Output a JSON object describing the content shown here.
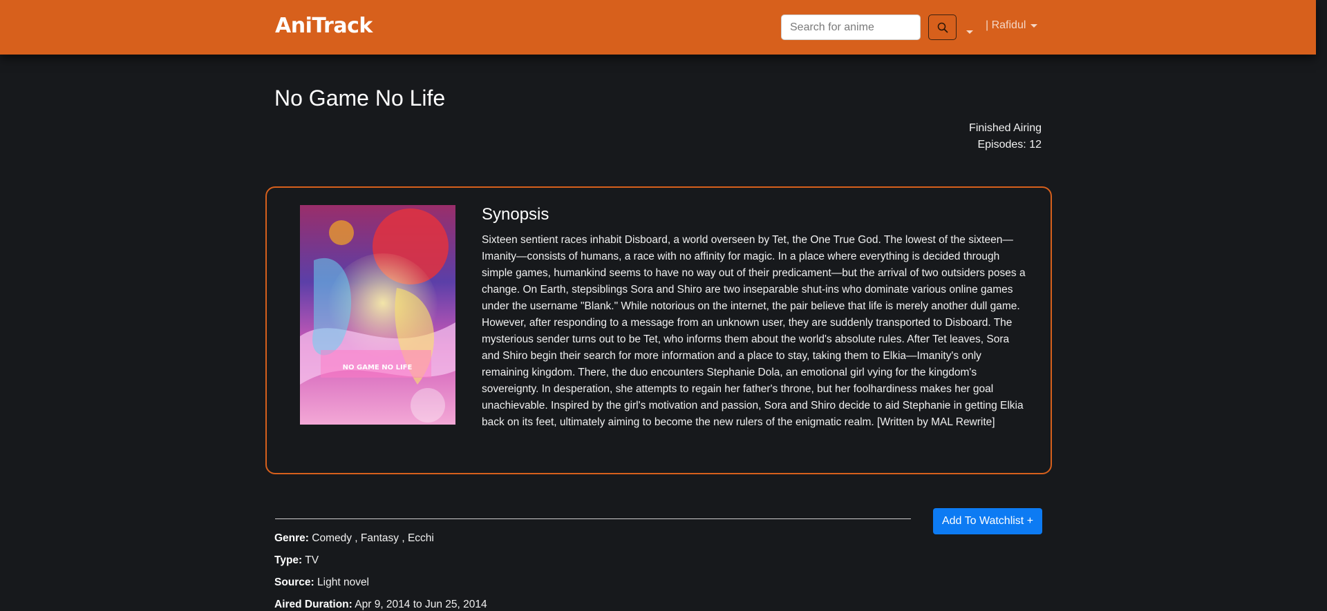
{
  "nav": {
    "brand": "AniTrack",
    "search_placeholder": "Search for anime",
    "search_value": "",
    "user_label": "| Rafidul"
  },
  "anime": {
    "title": "No Game No Life",
    "status": "Finished Airing",
    "episodes": "Episodes: 12",
    "poster_title_text": "NO GAME NO LIFE",
    "synopsis_heading": "Synopsis",
    "synopsis": "Sixteen sentient races inhabit Disboard, a world overseen by Tet, the One True God. The lowest of the sixteen—Imanity—consists of humans, a race with no affinity for magic. In a place where everything is decided through simple games, humankind seems to have no way out of their predicament—but the arrival of two outsiders poses a change. On Earth, stepsiblings Sora and Shiro are two inseparable shut-ins who dominate various online games under the username \"Blank.\" While notorious on the internet, the pair believe that life is merely another dull game. However, after responding to a message from an unknown user, they are suddenly transported to Disboard. The mysterious sender turns out to be Tet, who informs them about the world's absolute rules. After Tet leaves, Sora and Shiro begin their search for more information and a place to stay, taking them to Elkia—Imanity's only remaining kingdom. There, the duo encounters Stephanie Dola, an emotional girl vying for the kingdom's sovereignty. In desperation, she attempts to regain her father's throne, but her foolhardiness makes her goal unachievable. Inspired by the girl's motivation and passion, Sora and Shiro decide to aid Stephanie in getting Elkia back on its feet, ultimately aiming to become the new rulers of the enigmatic realm. [Written by MAL Rewrite]"
  },
  "actions": {
    "add_watchlist": "Add To Watchlist +"
  },
  "details": {
    "genre_label": "Genre:",
    "genre_value": "Comedy , Fantasy , Ecchi",
    "type_label": "Type:",
    "type_value": "TV",
    "source_label": "Source:",
    "source_value": "Light novel",
    "aired_label": "Aired Duration:",
    "aired_value": "Apr 9, 2014 to Jun 25, 2014"
  },
  "colors": {
    "navbar": "#d7601c",
    "background": "#17191c",
    "accent_border": "#d7601c",
    "primary_button": "#0d7bf3"
  },
  "icons": {
    "search": "search-icon",
    "caret": "chevron-down-icon"
  }
}
